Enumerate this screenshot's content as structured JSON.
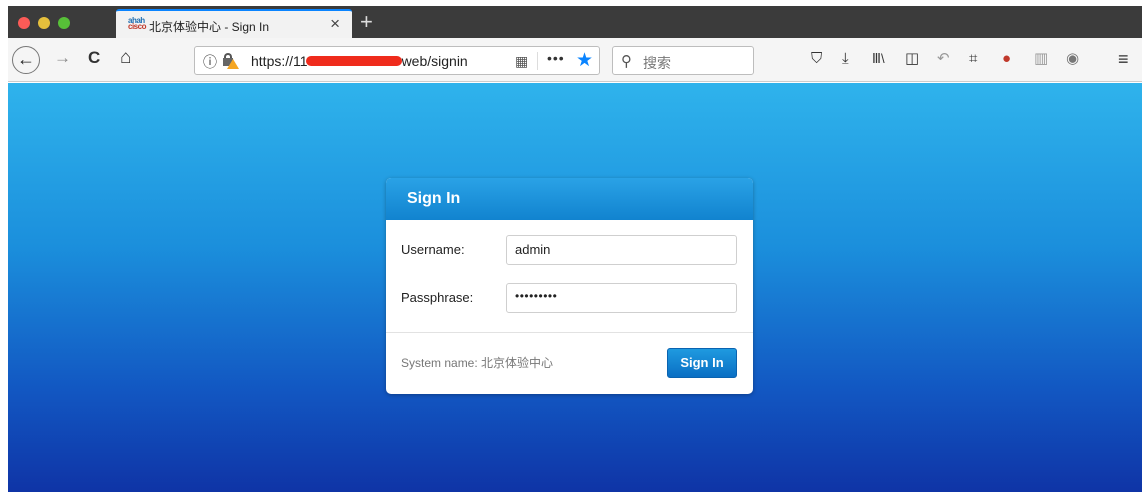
{
  "browser": {
    "tab": {
      "title": "北京体验中心 - Sign In",
      "favicon_top": "ahah",
      "favicon_bottom": "cisco",
      "close": "×"
    },
    "new_tab": "+",
    "nav": {
      "back": "←",
      "forward": "→",
      "reload": "C",
      "home": "⌂"
    },
    "url": {
      "info_icon": "ⓘ",
      "prefix": "https://11",
      "suffix": "web/signin",
      "qr": "▦",
      "more": "•••",
      "star": "★"
    },
    "search": {
      "icon": "⚲",
      "placeholder": "搜索"
    },
    "toolbar_icons": [
      "pocket-icon",
      "download-icon",
      "library-icon",
      "sidebar-icon",
      "undo-icon",
      "crop-icon",
      "extension-icon",
      "book-icon",
      "globe-icon",
      "menu-icon"
    ],
    "toolbar_glyphs": [
      "⛉",
      "⤓",
      "Ⅲ\\",
      "◫",
      "↶",
      "⌗",
      "●",
      "▥",
      "◉",
      "≡"
    ]
  },
  "dialog": {
    "title": "Sign In",
    "username_label": "Username:",
    "username_value": "admin",
    "passphrase_label": "Passphrase:",
    "passphrase_value": "•••••••••",
    "system_name": "System name: 北京体验中心",
    "signin_button": "Sign In"
  },
  "colors": {
    "accent": "#0a84ff",
    "page_gradient_top": "#2fb3ec",
    "page_gradient_bottom": "#0f34a6",
    "button": "#0a6fc4"
  }
}
